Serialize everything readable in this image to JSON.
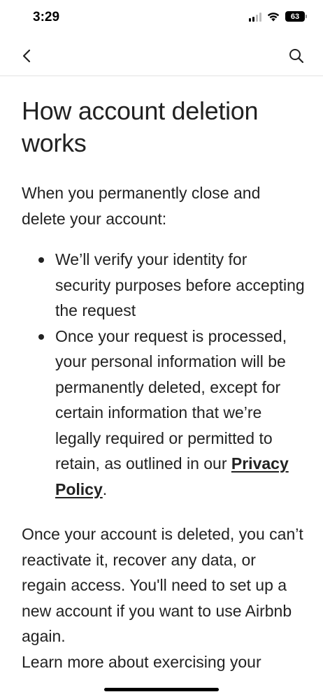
{
  "status": {
    "time": "3:29",
    "battery": "63"
  },
  "nav": {
    "back_icon": "chevron-left-icon",
    "search_icon": "search-icon"
  },
  "article": {
    "title": "How account deletion works",
    "intro": "When you permanently close and delete your account:",
    "bullets": [
      "We’ll verify your identity for security purposes before accepting the request",
      "Once your request is processed, your personal information will be permanently deleted, except for certain information that we’re legally required or permitted to retain, as outlined in our "
    ],
    "privacy_link": "Privacy Policy",
    "privacy_suffix": ".",
    "closing": "Once your account is deleted, you can’t reactivate it, recover any data, or regain access. You'll need to set up a new account if you want to use Airbnb again.",
    "learn_more": "Learn more about exercising your"
  },
  "colors": {
    "text": "#222222",
    "divider": "#e3e3e3",
    "background": "#ffffff"
  }
}
